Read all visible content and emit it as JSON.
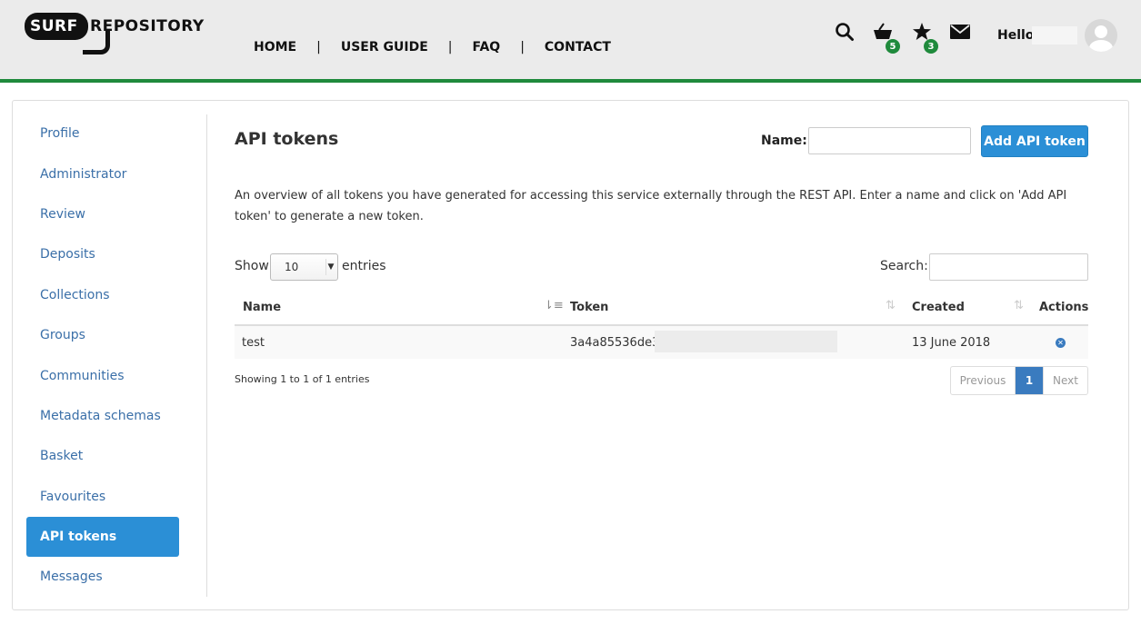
{
  "header": {
    "logo_surf": "SURF",
    "logo_repository": "REPOSITORY",
    "nav": [
      "HOME",
      "USER GUIDE",
      "FAQ",
      "CONTACT"
    ],
    "nav_separator": "|",
    "basket_count": "5",
    "favourites_count": "3",
    "hello": "Hello"
  },
  "sidebar": {
    "items": [
      {
        "label": "Profile"
      },
      {
        "label": "Administrator"
      },
      {
        "label": "Review"
      },
      {
        "label": "Deposits"
      },
      {
        "label": "Collections"
      },
      {
        "label": "Groups"
      },
      {
        "label": "Communities"
      },
      {
        "label": "Metadata schemas"
      },
      {
        "label": "Basket"
      },
      {
        "label": "Favourites"
      },
      {
        "label": "API tokens",
        "active": true
      },
      {
        "label": "Messages"
      }
    ]
  },
  "main": {
    "title": "API tokens",
    "name_label": "Name:",
    "name_value": "",
    "add_button": "Add API token",
    "description": "An overview of all tokens you have generated for accessing this service externally through the REST API. Enter a name and click on 'Add API token' to generate a new token.",
    "show_label": "Show",
    "page_size": "10",
    "entries_label": "entries",
    "search_label": "Search:",
    "search_value": "",
    "table": {
      "columns": [
        "Name",
        "Token",
        "Created",
        "Actions"
      ],
      "rows": [
        {
          "name": "test",
          "token": "3a4a85536de3a",
          "created": "13 June 2018"
        }
      ]
    },
    "info": "Showing 1 to 1 of 1 entries",
    "pagination": {
      "previous": "Previous",
      "current": "1",
      "next": "Next"
    }
  },
  "colors": {
    "accent": "#2b8fd6",
    "green": "#1f8a3c",
    "link": "#3a6fa8"
  }
}
